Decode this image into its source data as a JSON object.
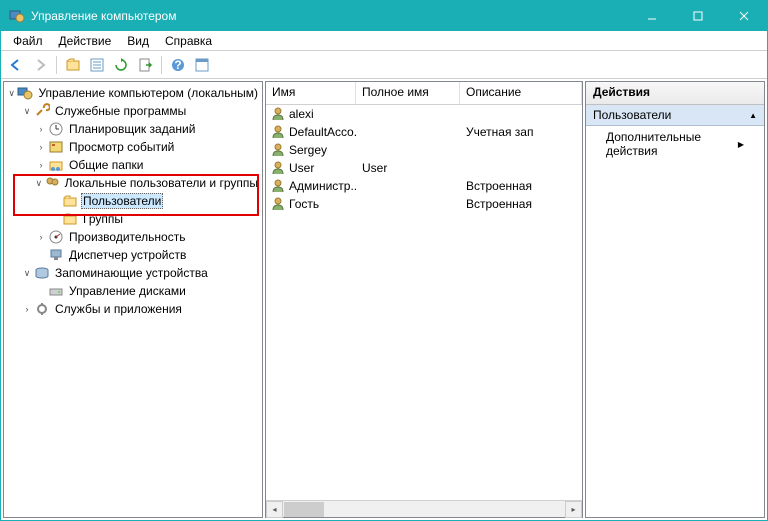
{
  "window": {
    "title": "Управление компьютером"
  },
  "menu": {
    "file": "Файл",
    "action": "Действие",
    "view": "Вид",
    "help": "Справка"
  },
  "tree": {
    "root": "Управление компьютером (локальным)",
    "system_tools": "Служебные программы",
    "scheduler": "Планировщик заданий",
    "eventviewer": "Просмотр событий",
    "shared": "Общие папки",
    "localusers": "Локальные пользователи и группы",
    "users": "Пользователи",
    "groups": "Группы",
    "perf": "Производительность",
    "devmgr": "Диспетчер устройств",
    "storage": "Запоминающие устройства",
    "diskmgmt": "Управление дисками",
    "services": "Службы и приложения"
  },
  "list": {
    "cols": {
      "name": "Имя",
      "fullname": "Полное имя",
      "desc": "Описание"
    },
    "rows": [
      {
        "name": "alexi",
        "full": "",
        "desc": ""
      },
      {
        "name": "DefaultAcco...",
        "full": "",
        "desc": "Учетная зап"
      },
      {
        "name": "Sergey",
        "full": "",
        "desc": ""
      },
      {
        "name": "User",
        "full": "User",
        "desc": ""
      },
      {
        "name": "Администр...",
        "full": "",
        "desc": "Встроенная"
      },
      {
        "name": "Гость",
        "full": "",
        "desc": "Встроенная"
      }
    ]
  },
  "actions": {
    "title": "Действия",
    "section": "Пользователи",
    "more": "Дополнительные действия"
  }
}
